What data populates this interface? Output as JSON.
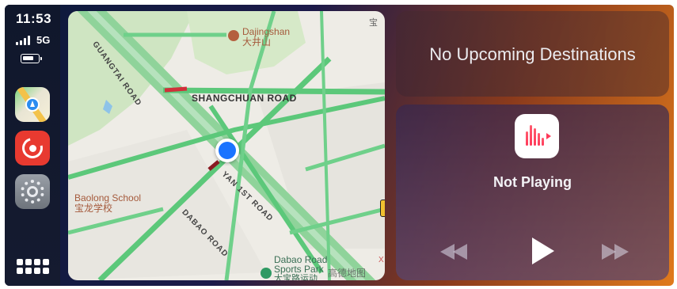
{
  "status": {
    "time": "11:53",
    "network": "5G",
    "signal_bars": 4,
    "battery_level": 0.6
  },
  "sidebar": {
    "apps": [
      {
        "name": "Maps",
        "icon": "maps-icon"
      },
      {
        "name": "Music",
        "icon": "music-app-icon"
      },
      {
        "name": "Settings",
        "icon": "settings-icon"
      }
    ],
    "grid_icon": "app-grid-icon"
  },
  "map": {
    "labels": {
      "dajingshan_en": "Dajingshan",
      "dajingshan_cn": "大井山",
      "guangtai_road": "GUANGTAI ROAD",
      "shangchuan_road": "SHANGCHUAN ROAD",
      "yan_1st_road": "YAN 1ST ROAD",
      "dabao_road": "DABAO ROAD",
      "baolong_school_en": "Baolong School",
      "baolong_school_cn": "宝龙学校",
      "dabao_sports_1": "Dabao Road",
      "dabao_sports_2": "Sports Park",
      "dabao_sports_cn": "大宝路运动",
      "corner_cn": "宝",
      "watermark": "高德地图",
      "side_x": "X"
    }
  },
  "destinations": {
    "text": "No Upcoming Destinations"
  },
  "now_playing": {
    "status": "Not Playing",
    "controls": {
      "rewind": "rewind-icon",
      "play": "play-icon",
      "forward": "fast-forward-icon"
    }
  },
  "colors": {
    "sidebar_bg": "#10172c",
    "road_green": "#5cc87a",
    "road_main": "#8fd39a",
    "location_blue": "#1a73ff",
    "map_bg": "#eeece6",
    "music_red": "#e83a30"
  }
}
